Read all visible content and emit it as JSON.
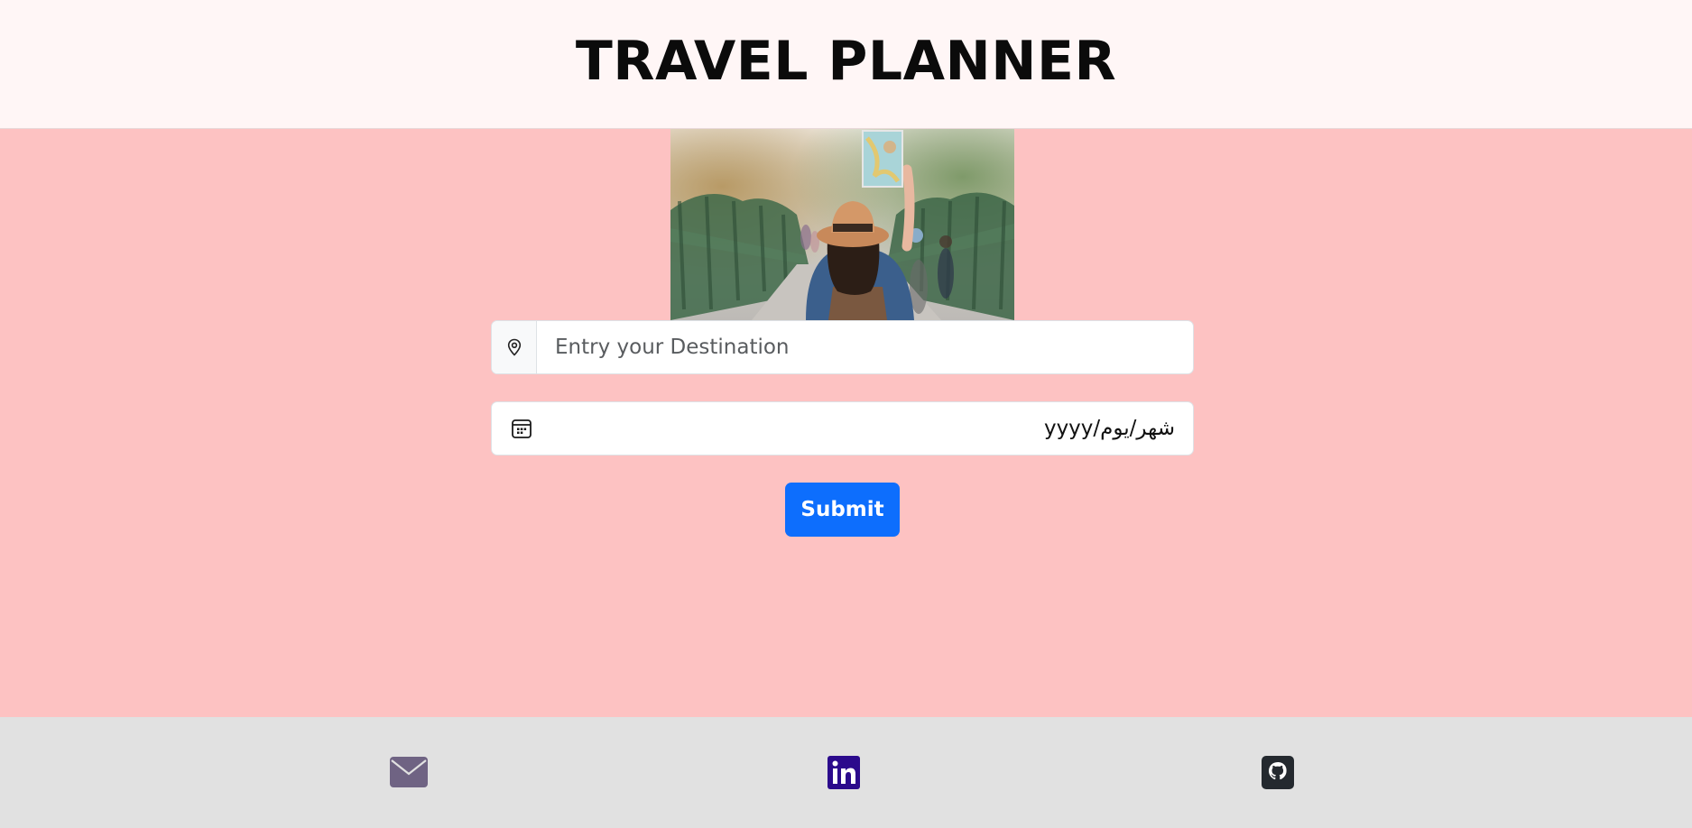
{
  "header": {
    "title": "TRAVEL PLANNER"
  },
  "hero": {
    "image": "traveler-with-map-photo"
  },
  "form": {
    "destination_placeholder": "Entry your Destination",
    "destination_value": "",
    "destination_icon": "map-pin-icon",
    "date_display": "yyyy/شهر/يوم",
    "date_icon": "calendar-icon",
    "submit_label": "Submit",
    "submit_color": "#0d6efd"
  },
  "footer": {
    "links": [
      {
        "icon": "mail-icon",
        "color": "#6f6383"
      },
      {
        "icon": "linkedin-icon",
        "color": "#2b0a8c"
      },
      {
        "icon": "github-icon",
        "color": "#24292f"
      }
    ]
  },
  "colors": {
    "header_bg": "#fff6f6",
    "main_bg": "#fdc2c2",
    "footer_bg": "#e1e1e1"
  }
}
